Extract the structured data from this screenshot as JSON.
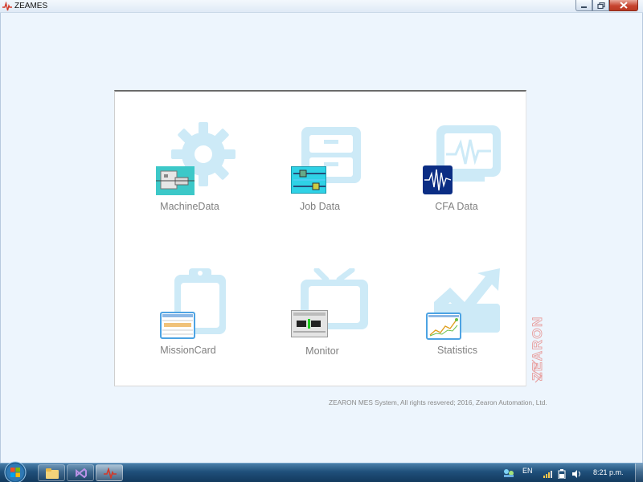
{
  "window": {
    "title": "ZEAMES",
    "icon": "pulse-icon",
    "buttons": [
      "minimize-icon",
      "maximize-icon",
      "close-icon"
    ]
  },
  "modules": [
    {
      "label": "MachineData",
      "icon": "gear-icon"
    },
    {
      "label": "Job Data",
      "icon": "cabinet-icon"
    },
    {
      "label": "CFA Data",
      "icon": "waveform-monitor-icon"
    },
    {
      "label": "MissionCard",
      "icon": "clipboard-icon"
    },
    {
      "label": "Monitor",
      "icon": "tv-icon"
    },
    {
      "label": "Statistics",
      "icon": "chart-arrow-icon"
    }
  ],
  "watermark": "ZEARON",
  "footer": {
    "copyright": "ZEARON MES System, All rights resvered; 2016, Zearon Automation, Ltd."
  },
  "taskbar": {
    "language": "EN",
    "time": "8:21 p.m."
  },
  "colors": {
    "accent_light": "#cdeaf7",
    "label": "#7f7f7f",
    "brand_red": "#d9534f"
  }
}
